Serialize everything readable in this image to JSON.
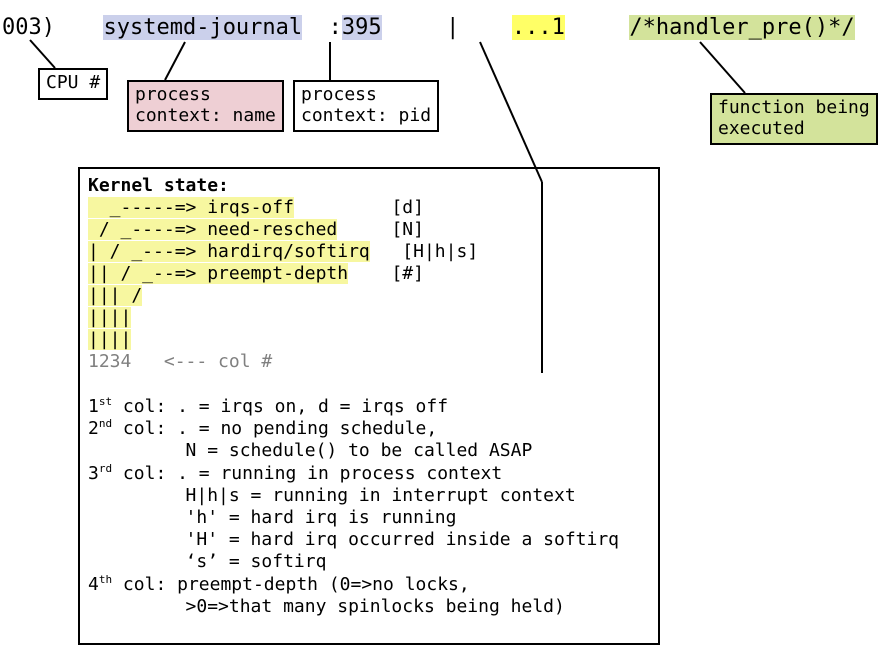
{
  "topline": {
    "cpu": "003)",
    "procname": "systemd-journal",
    "pidprefix": ":",
    "pid": "395",
    "bar": "|",
    "flags": "...1",
    "funcOpen": "/* ",
    "funcName": "handler_pre()",
    "funcClose": " */"
  },
  "callouts": {
    "cpu": "CPU #",
    "procname_l1": "process",
    "procname_l2": "context: name",
    "pid_l1": "process",
    "pid_l2": "context: pid",
    "func_l1": "function being",
    "func_l2": "executed"
  },
  "kernelbox": {
    "title": "Kernel state:",
    "l1a": "  _-----=> ",
    "l1b": "irqs-off",
    "l1c": "         [d]",
    "l2a": " / _----=> ",
    "l2b": "need-resched",
    "l2c": "     [N]",
    "l3a": "| / _---=> ",
    "l3b": "hardirq/softirq",
    "l3c": "   [H|h|s]",
    "l4a": "|| / _--=> ",
    "l4b": "preempt-depth",
    "l4c": "    [#]",
    "l5": "||| /",
    "l6": "||||",
    "l7": "||||",
    "l8num": "1234",
    "l8tail": "   <--- col #",
    "d1a": "1",
    "d1sup": "st",
    "d1b": " col: . = irqs on, d = irqs off",
    "d2a": "2",
    "d2sup": "nd",
    "d2b": " col: . = no pending schedule,",
    "d2c": "         N = schedule() to be called ASAP",
    "d3a": "3",
    "d3sup": "rd",
    "d3b": " col: . = running in process context",
    "d3c": "         H|h|s = running in interrupt context",
    "d3d": "         'h' = hard irq is running",
    "d3e": "         'H' = hard irq occurred inside a softirq",
    "d3f": "         ‘s’ = softirq",
    "d4a": "4",
    "d4sup": "th",
    "d4b": " col: preempt-depth (0=>no locks,",
    "d4c": "         >0=>that many spinlocks being held)"
  }
}
